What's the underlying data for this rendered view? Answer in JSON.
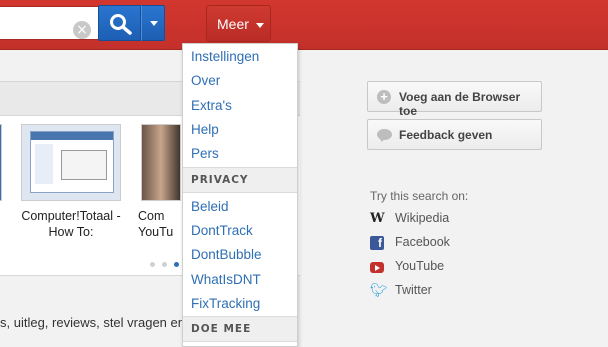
{
  "header": {
    "search_clear_icon": "clear-x-icon",
    "search_button_icon": "magnifier-icon",
    "more_button": "Meer"
  },
  "menu": {
    "items_top": [
      "Instellingen",
      "Over",
      "Extra's",
      "Help",
      "Pers"
    ],
    "section_privacy": "PRIVACY",
    "items_privacy": [
      "Beleid",
      "DontTrack",
      "DontBubble",
      "WhatIsDNT",
      "FixTracking"
    ],
    "section_join": "DOE MEE"
  },
  "results": {
    "thumb1_caption": "Computer!Totaal - How To:",
    "thumb2_caption": "Com YouTu",
    "snippet": "s, uitleg, reviews, stel vragen en"
  },
  "sidebar": {
    "add_to_browser": "Voeg aan de Browser toe",
    "feedback": "Feedback geven",
    "try_search_on": "Try this search on:",
    "sites": [
      {
        "name": "Wikipedia",
        "icon": "wikipedia-icon"
      },
      {
        "name": "Facebook",
        "icon": "facebook-icon"
      },
      {
        "name": "YouTube",
        "icon": "youtube-icon"
      },
      {
        "name": "Twitter",
        "icon": "twitter-icon"
      }
    ]
  },
  "colors": {
    "header_red": "#c4302b",
    "search_blue": "#1d5fb3",
    "link_blue": "#2f6fb4"
  }
}
